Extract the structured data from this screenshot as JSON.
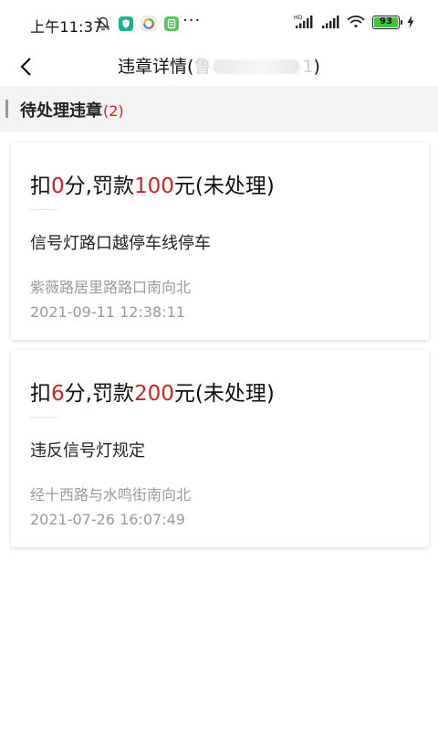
{
  "status_bar": {
    "time": "上午11:37",
    "more": "···",
    "battery_level": "93",
    "signal_label": "HD",
    "colors": {
      "battery_fill": "#3ec43e",
      "app1": "#19b38c",
      "app3": "#5cc45c"
    }
  },
  "header": {
    "title_prefix": "违章详情(",
    "title_visible_start": "鲁",
    "title_visible_end": "1",
    "title_suffix": ")"
  },
  "section": {
    "title": "待处理违章",
    "count": "(2)"
  },
  "violations": [
    {
      "deduct_prefix": "扣",
      "points": "0",
      "mid": "分,罚款",
      "fine": "100",
      "suffix": "元(未处理)",
      "description": "信号灯路口越停车线停车",
      "location": "紫薇路居里路路口南向北",
      "time": "2021-09-11 12:38:11"
    },
    {
      "deduct_prefix": "扣",
      "points": "6",
      "mid": "分,罚款",
      "fine": "200",
      "suffix": "元(未处理)",
      "description": "违反信号灯规定",
      "location": "经十西路与水鸣街南向北",
      "time": "2021-07-26 16:07:49"
    }
  ],
  "colors": {
    "accent_red": "#cf2222",
    "section_bg": "#f3f3f3",
    "muted_text": "#9a9a9a"
  }
}
